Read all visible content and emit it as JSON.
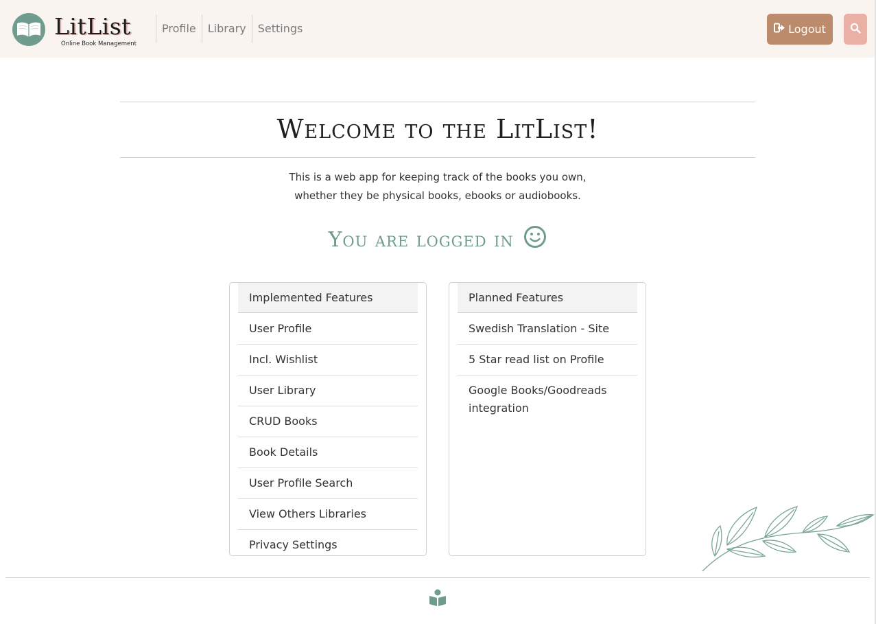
{
  "brand": {
    "title": "LitList",
    "subtitle": "Online Book Management",
    "logo_icon": "open-book-icon"
  },
  "nav": {
    "links": [
      "Profile",
      "Library",
      "Settings"
    ],
    "logout_label": "Logout",
    "logout_icon": "sign-out-icon",
    "search_icon": "search-icon"
  },
  "main": {
    "welcome": "Welcome to the LitList!",
    "intro_line1": "This is a web app for keeping track of the books you own,",
    "intro_line2": "whether they be physical books, ebooks or audiobooks.",
    "logged_in": "You are logged in",
    "logged_in_icon": "smiley-icon"
  },
  "implemented": {
    "header": "Implemented Features",
    "items": [
      "User Profile",
      "Incl. Wishlist",
      "User Library",
      "CRUD Books",
      "Book Details",
      "User Profile Search",
      "View Others Libraries",
      "Privacy Settings"
    ]
  },
  "planned": {
    "header": "Planned Features",
    "items": [
      "Swedish Translation - Site",
      "5 Star read list on Profile",
      "Google Books/Goodreads integration"
    ]
  },
  "footer": {
    "icon": "book-reader-icon"
  },
  "colors": {
    "accent": "#6f9c8e",
    "navbar_bg": "#f9f4f0",
    "logout_bg": "#bc8b6c",
    "search_bg": "#eab0a6"
  }
}
